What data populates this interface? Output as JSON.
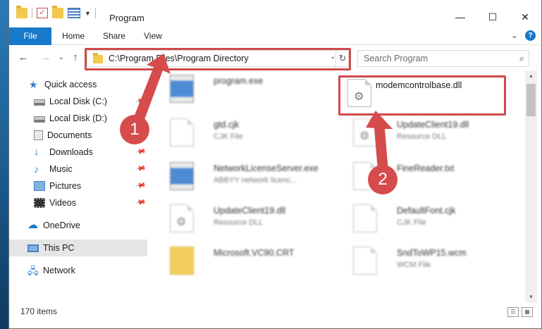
{
  "window": {
    "title": "Program",
    "minimize": "—",
    "maximize": "☐",
    "close": "✕"
  },
  "ribbon": {
    "file": "File",
    "tabs": [
      "Home",
      "Share",
      "View"
    ],
    "expand": "⌄",
    "help": "?"
  },
  "navigation": {
    "back": "←",
    "forward": "→",
    "recent": "⌄",
    "up": "↑",
    "address": "C:\\Program Files\\Program Directory",
    "address_dropdown": "⌄",
    "refresh": "↻",
    "search_placeholder": "Search Program",
    "search_icon": "⌕"
  },
  "sidebar": {
    "items": [
      {
        "label": "Quick access",
        "icon": "star-icon",
        "pinned": false
      },
      {
        "label": "Local Disk (C:)",
        "icon": "disk-icon",
        "pinned": true
      },
      {
        "label": "Local Disk (D:)",
        "icon": "disk-icon",
        "pinned": false
      },
      {
        "label": "Documents",
        "icon": "documents-icon",
        "pinned": true
      },
      {
        "label": "Downloads",
        "icon": "download-icon",
        "pinned": true
      },
      {
        "label": "Music",
        "icon": "music-icon",
        "pinned": true
      },
      {
        "label": "Pictures",
        "icon": "pictures-icon",
        "pinned": true
      },
      {
        "label": "Videos",
        "icon": "videos-icon",
        "pinned": true
      },
      {
        "label": "OneDrive",
        "icon": "cloud-icon",
        "pinned": false
      },
      {
        "label": "This PC",
        "icon": "computer-icon",
        "pinned": false
      },
      {
        "label": "Network",
        "icon": "network-icon",
        "pinned": false
      }
    ],
    "selected": "This PC"
  },
  "files": [
    {
      "name": "program.exe",
      "type": "",
      "icon": "exe-icon"
    },
    {
      "name": "modemcontrolbase.dll",
      "type": "",
      "icon": "dll-icon"
    },
    {
      "name": "gtd.cjk",
      "type": "CJK File",
      "icon": "file-icon"
    },
    {
      "name": "UpdateClient19.dll",
      "type": "Resource DLL",
      "icon": "dll-icon"
    },
    {
      "name": "NetworkLicenseServer.exe",
      "type": "ABBYY network licenc...",
      "icon": "exe-icon"
    },
    {
      "name": "FineReader.txt",
      "type": "",
      "icon": "file-icon"
    },
    {
      "name": "UpdateClient19.dll",
      "type": "Resource DLL",
      "icon": "dll-icon"
    },
    {
      "name": "DefaultFont.cjk",
      "type": "CJK File",
      "icon": "file-icon"
    },
    {
      "name": "Microsoft.VC90.CRT",
      "type": "",
      "icon": "folder-icon"
    },
    {
      "name": "SndToWP15.wcm",
      "type": "WCM File",
      "icon": "file-icon"
    }
  ],
  "status": {
    "item_count": "170 items"
  },
  "annotations": {
    "step1": "1",
    "step2": "2",
    "color": "#d14a4a"
  }
}
